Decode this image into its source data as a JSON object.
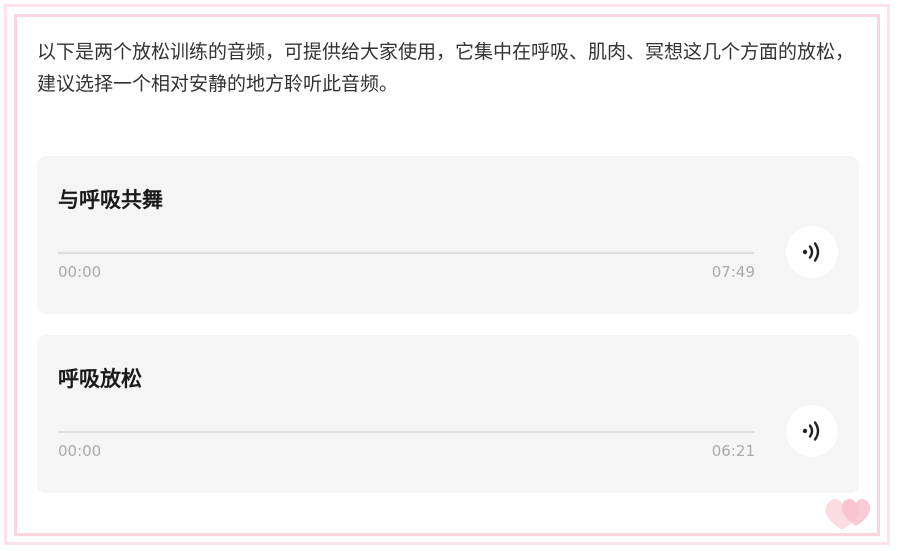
{
  "intro": "以下是两个放松训练的音频，可提供给大家使用，它集中在呼吸、肌肉、冥想这几个方面的放松，建议选择一个相对安静的地方聆听此音频。",
  "tracks": [
    {
      "title": "与呼吸共舞",
      "current_time": "00:00",
      "duration": "07:49",
      "progress": 0,
      "icon": "sound-wave-icon"
    },
    {
      "title": "呼吸放松",
      "current_time": "00:00",
      "duration": "06:21",
      "progress": 0,
      "icon": "sound-wave-icon"
    }
  ],
  "colors": {
    "frame": "#fbd5de",
    "card_bg": "#f5f5f5",
    "time_text": "#aaaaaa",
    "title_text": "#1a1a1a"
  }
}
